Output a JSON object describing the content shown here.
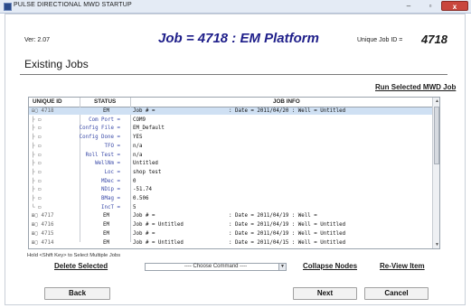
{
  "window": {
    "title": "PULSE DIRECTIONAL MWD STARTUP",
    "minimize": "–",
    "maximize": "▫",
    "close": "x"
  },
  "header": {
    "version": "Ver: 2.07",
    "job_title": "Job = 4718 : EM Platform",
    "unique_label": "Unique Job ID =",
    "unique_value": "4718"
  },
  "section_title": "Existing Jobs",
  "links": {
    "run": "Run Selected MWD Job",
    "delete": "Delete Selected",
    "collapse": "Collapse Nodes",
    "review": "Re-View Item"
  },
  "grid": {
    "columns": {
      "uid": "UNIQUE ID",
      "status": "STATUS",
      "info": "JOB INFO"
    },
    "rows": [
      {
        "uid": "⊟▢ 4718",
        "status": "EM",
        "job": "Job # =",
        "date": ": Date = 2011/04/20 : Well = Untitled"
      },
      {
        "uid": "├ ▭",
        "key": "Com Port =",
        "val": "COM9"
      },
      {
        "uid": "├ ▭",
        "key": "Config File =",
        "val": "EM_Default"
      },
      {
        "uid": "├ ▭",
        "key": "Config Done =",
        "val": "YES"
      },
      {
        "uid": "├ ▭",
        "key": "TFO =",
        "val": "n/a"
      },
      {
        "uid": "├ ▭",
        "key": "Roll Test =",
        "val": "n/a"
      },
      {
        "uid": "├ ▭",
        "key": "WellNm =",
        "val": "Untitled"
      },
      {
        "uid": "├ ▭",
        "key": "Loc =",
        "val": "shop test"
      },
      {
        "uid": "├ ▭",
        "key": "MDec =",
        "val": "0"
      },
      {
        "uid": "├ ▭",
        "key": "NDip =",
        "val": "-51.74"
      },
      {
        "uid": "├ ▭",
        "key": "BMag =",
        "val": "0.506"
      },
      {
        "uid": "└ ▭",
        "key": "IncT =",
        "val": "5"
      },
      {
        "uid": "⊞▢ 4717",
        "status": "EM",
        "job": "Job # =",
        "date": ": Date = 2011/04/19 : Well ="
      },
      {
        "uid": "⊞▢ 4716",
        "status": "EM",
        "job": "Job # = Untitled",
        "date": ": Date = 2011/04/19 : Well = Untitled"
      },
      {
        "uid": "⊞▢ 4715",
        "status": "EM",
        "job": "Job # =",
        "date": ": Date = 2011/04/19 : Well = Untitled"
      },
      {
        "uid": "⊞▢ 4714",
        "status": "EM",
        "job": "Job # = Untitled",
        "date": ": Date = 2011/04/15 : Well = Untitled"
      }
    ]
  },
  "hint": "Hold <Shift Key> to Select Multiple Jobs",
  "command": {
    "placeholder": "---- Choose Command ----",
    "arrow": "▼"
  },
  "scroll": {
    "up": "▲",
    "down": "▼"
  },
  "buttons": {
    "back": "Back",
    "next": "Next",
    "cancel": "Cancel"
  },
  "colors": {
    "title_blue": "#1f1f8a",
    "selection": "#cfe0f3",
    "key_blue": "#3a4aa8"
  }
}
